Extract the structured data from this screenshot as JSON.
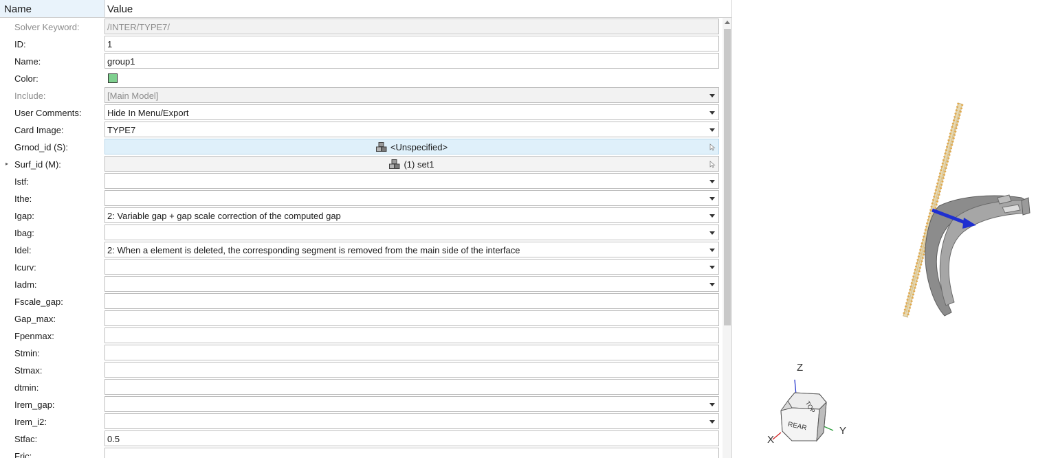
{
  "header": {
    "name_col": "Name",
    "value_col": "Value"
  },
  "rows": [
    {
      "label": "Solver Keyword:",
      "value": "/INTER/TYPE7/"
    },
    {
      "label": "ID:",
      "value": "1"
    },
    {
      "label": "Name:",
      "value": "group1"
    },
    {
      "label": "Color:",
      "value": "",
      "color": "#7fd08f"
    },
    {
      "label": "Include:",
      "value": "[Main Model]"
    },
    {
      "label": "User Comments:",
      "value": "Hide In Menu/Export"
    },
    {
      "label": "Card Image:",
      "value": "TYPE7"
    },
    {
      "label": "Grnod_id (S):",
      "value": "<Unspecified>"
    },
    {
      "label": "Surf_id (M):",
      "value": "(1) set1"
    },
    {
      "label": "Istf:",
      "value": ""
    },
    {
      "label": "Ithe:",
      "value": ""
    },
    {
      "label": "Igap:",
      "value": "2: Variable gap + gap scale correction of the computed gap"
    },
    {
      "label": "Ibag:",
      "value": ""
    },
    {
      "label": "Idel:",
      "value": "2: When a element is deleted, the corresponding segment is removed from the main side of the interface"
    },
    {
      "label": "Icurv:",
      "value": ""
    },
    {
      "label": "Iadm:",
      "value": ""
    },
    {
      "label": "Fscale_gap:",
      "value": ""
    },
    {
      "label": "Gap_max:",
      "value": ""
    },
    {
      "label": "Fpenmax:",
      "value": ""
    },
    {
      "label": "Stmin:",
      "value": ""
    },
    {
      "label": "Stmax:",
      "value": ""
    },
    {
      "label": "dtmin:",
      "value": ""
    },
    {
      "label": "Irem_gap:",
      "value": ""
    },
    {
      "label": "Irem_i2:",
      "value": ""
    },
    {
      "label": "Stfac:",
      "value": "0.5"
    },
    {
      "label": "Fric:",
      "value": ""
    }
  ],
  "viewcube": {
    "top_face": "TOP",
    "front_face": "REAR",
    "axis_z": "Z",
    "axis_y": "Y",
    "axis_x": "X"
  },
  "colors": {
    "accent_entity": "#dff0fa",
    "surface_plane": "#e8d9b0",
    "nodes": "#e3a84a",
    "part": "#8c8c8c",
    "vector": "#1f2fd0"
  }
}
